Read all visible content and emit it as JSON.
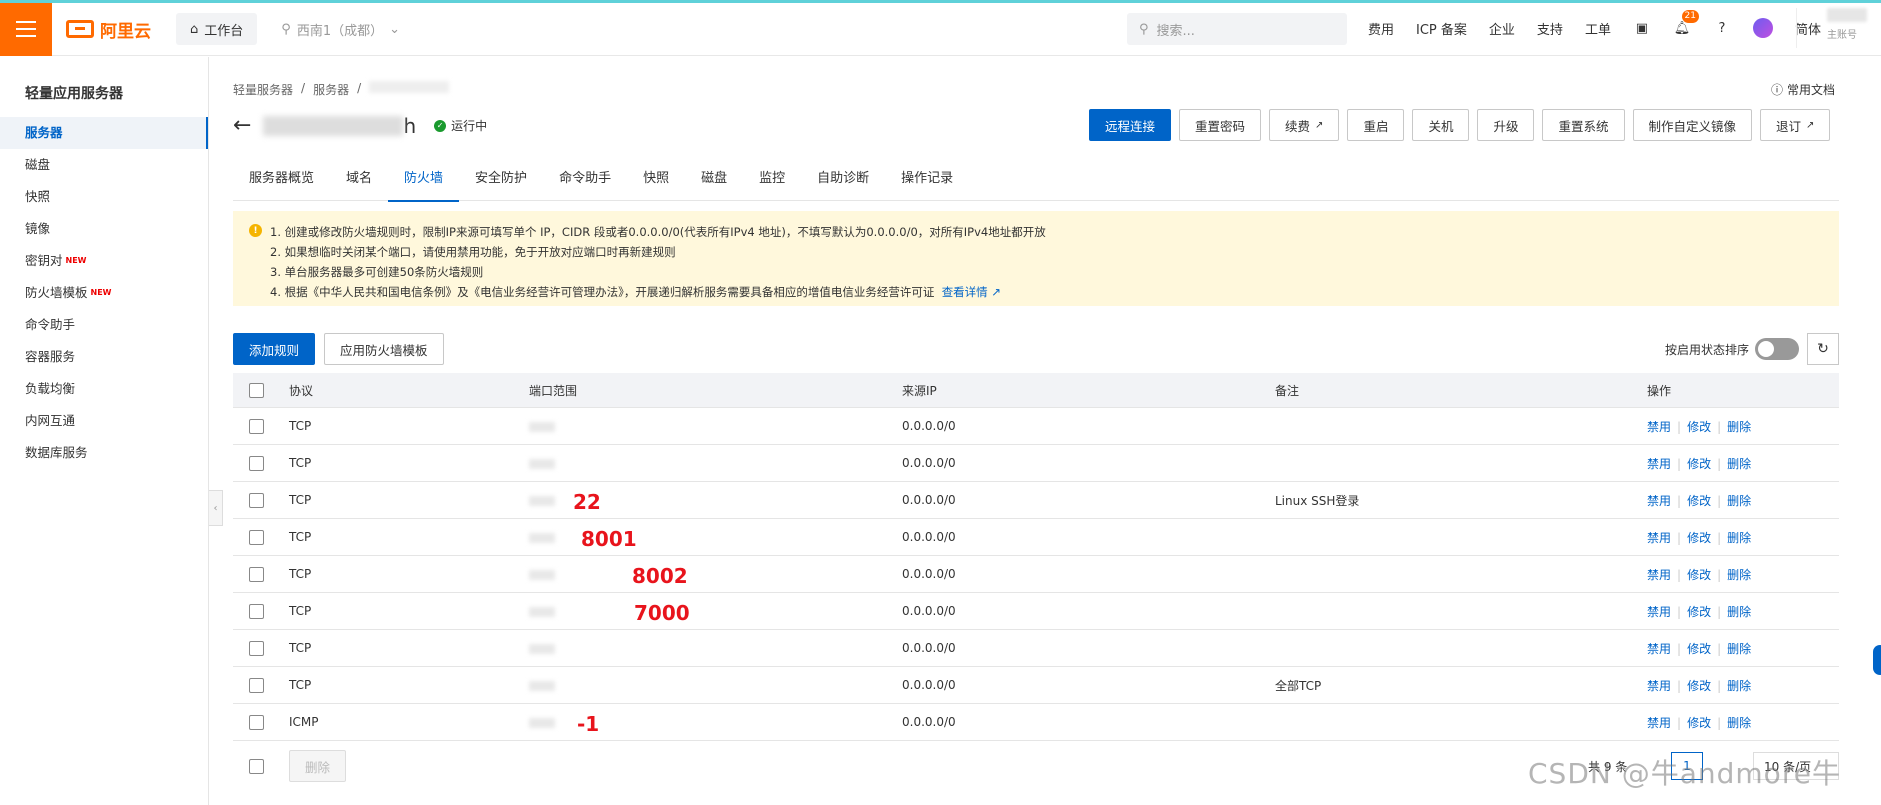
{
  "topbar": {
    "logo_text": "阿里云",
    "workbench_label": "工作台",
    "region_label": "西南1（成都）",
    "search_placeholder": "搜索...",
    "nav_links": [
      "费用",
      "ICP 备案",
      "企业",
      "支持",
      "工单"
    ],
    "notification_count": "21",
    "language_label": "简体",
    "account_label": "主账号"
  },
  "sidebar": {
    "title": "轻量应用服务器",
    "items": [
      {
        "label": "服务器",
        "active": true,
        "new": false
      },
      {
        "label": "磁盘",
        "active": false,
        "new": false
      },
      {
        "label": "快照",
        "active": false,
        "new": false
      },
      {
        "label": "镜像",
        "active": false,
        "new": false
      },
      {
        "label": "密钥对",
        "active": false,
        "new": true
      },
      {
        "label": "防火墙模板",
        "active": false,
        "new": true
      },
      {
        "label": "命令助手",
        "active": false,
        "new": false
      },
      {
        "label": "容器服务",
        "active": false,
        "new": false
      },
      {
        "label": "负载均衡",
        "active": false,
        "new": false
      },
      {
        "label": "内网互通",
        "active": false,
        "new": false
      },
      {
        "label": "数据库服务",
        "active": false,
        "new": false
      }
    ],
    "new_badge": "NEW"
  },
  "breadcrumb": [
    "轻量服务器",
    "/",
    "服务器",
    "/"
  ],
  "common_docs": "常用文档",
  "server": {
    "name_suffix": "h",
    "status": "运行中"
  },
  "actions": [
    {
      "label": "远程连接",
      "primary": true,
      "external": false
    },
    {
      "label": "重置密码",
      "primary": false,
      "external": false
    },
    {
      "label": "续费",
      "primary": false,
      "external": true
    },
    {
      "label": "重启",
      "primary": false,
      "external": false
    },
    {
      "label": "关机",
      "primary": false,
      "external": false
    },
    {
      "label": "升级",
      "primary": false,
      "external": false
    },
    {
      "label": "重置系统",
      "primary": false,
      "external": false
    },
    {
      "label": "制作自定义镜像",
      "primary": false,
      "external": false
    },
    {
      "label": "退订",
      "primary": false,
      "external": true
    }
  ],
  "tabs": [
    {
      "label": "服务器概览",
      "active": false
    },
    {
      "label": "域名",
      "active": false
    },
    {
      "label": "防火墙",
      "active": true
    },
    {
      "label": "安全防护",
      "active": false
    },
    {
      "label": "命令助手",
      "active": false
    },
    {
      "label": "快照",
      "active": false
    },
    {
      "label": "磁盘",
      "active": false
    },
    {
      "label": "监控",
      "active": false
    },
    {
      "label": "自助诊断",
      "active": false
    },
    {
      "label": "操作记录",
      "active": false
    }
  ],
  "notice": {
    "lines": [
      "1. 创建或修改防火墙规则时，限制IP来源可填写单个 IP，CIDR 段或者0.0.0.0/0(代表所有IPv4 地址)，不填写默认为0.0.0.0/0，对所有IPv4地址都开放",
      "2. 如果想临时关闭某个端口，请使用禁用功能，免于开放对应端口时再新建规则",
      "3. 单台服务器最多可创建50条防火墙规则",
      "4. 根据《中华人民共和国电信条例》及《电信业务经营许可管理办法》，开展递归解析服务需要具备相应的增值电信业务经营许可证"
    ],
    "link_label": "查看详情"
  },
  "toolbar": {
    "add_rule": "添加规则",
    "apply_template": "应用防火墙模板",
    "sort_label": "按启用状态排序"
  },
  "table": {
    "headers": [
      "协议",
      "端口范围",
      "来源IP",
      "备注",
      "操作"
    ],
    "rows": [
      {
        "protocol": "TCP",
        "port_annotation": "",
        "source": "0.0.0.0/0",
        "note": ""
      },
      {
        "protocol": "TCP",
        "port_annotation": "",
        "source": "0.0.0.0/0",
        "note": ""
      },
      {
        "protocol": "TCP",
        "port_annotation": "22",
        "source": "0.0.0.0/0",
        "note": "Linux SSH登录"
      },
      {
        "protocol": "TCP",
        "port_annotation": "8001",
        "source": "0.0.0.0/0",
        "note": ""
      },
      {
        "protocol": "TCP",
        "port_annotation": "8002",
        "source": "0.0.0.0/0",
        "note": ""
      },
      {
        "protocol": "TCP",
        "port_annotation": "7000",
        "source": "0.0.0.0/0",
        "note": ""
      },
      {
        "protocol": "TCP",
        "port_annotation": "",
        "source": "0.0.0.0/0",
        "note": ""
      },
      {
        "protocol": "TCP",
        "port_annotation": "",
        "source": "0.0.0.0/0",
        "note": "全部TCP"
      },
      {
        "protocol": "ICMP",
        "port_annotation": "-1",
        "source": "0.0.0.0/0",
        "note": ""
      }
    ],
    "ops": [
      "禁用",
      "修改",
      "删除"
    ]
  },
  "footer": {
    "delete_label": "删除",
    "total_label": "共 9 条",
    "page": "1",
    "per_page": "10 条/页"
  },
  "watermark": "CSDN @牛andmore牛"
}
